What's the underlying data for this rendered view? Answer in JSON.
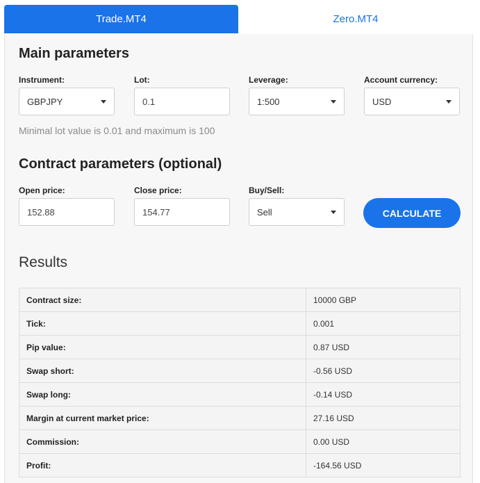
{
  "tabs": [
    {
      "label": "Trade.MT4",
      "active": true
    },
    {
      "label": "Zero.MT4",
      "active": false
    }
  ],
  "main": {
    "title": "Main parameters",
    "instrument": {
      "label": "Instrument:",
      "value": "GBPJPY"
    },
    "lot": {
      "label": "Lot:",
      "value": "0.1"
    },
    "leverage": {
      "label": "Leverage:",
      "value": "1:500"
    },
    "currency": {
      "label": "Account currency:",
      "value": "USD"
    },
    "hint": "Minimal lot value is 0.01 and maximum is 100"
  },
  "contract": {
    "title": "Contract parameters (optional)",
    "open_price": {
      "label": "Open price:",
      "value": "152.88"
    },
    "close_price": {
      "label": "Close price:",
      "value": "154.77"
    },
    "buy_sell": {
      "label": "Buy/Sell:",
      "value": "Sell"
    },
    "calculate_label": "CALCULATE"
  },
  "results": {
    "title": "Results",
    "rows": [
      {
        "key": "Contract size:",
        "value": "10000 GBP"
      },
      {
        "key": "Tick:",
        "value": "0.001"
      },
      {
        "key": "Pip value:",
        "value": "0.87 USD"
      },
      {
        "key": "Swap short:",
        "value": "-0.56 USD"
      },
      {
        "key": "Swap long:",
        "value": "-0.14 USD"
      },
      {
        "key": "Margin at current market price:",
        "value": "27.16 USD"
      },
      {
        "key": "Commission:",
        "value": "0.00 USD"
      },
      {
        "key": "Profit:",
        "value": "-164.56 USD"
      }
    ]
  },
  "colors": {
    "accent": "#1a73e8",
    "panel_bg": "#f7f7f7",
    "hint_text": "#8a8a8a"
  },
  "icons": {
    "select_arrow": "caret-down-icon"
  }
}
